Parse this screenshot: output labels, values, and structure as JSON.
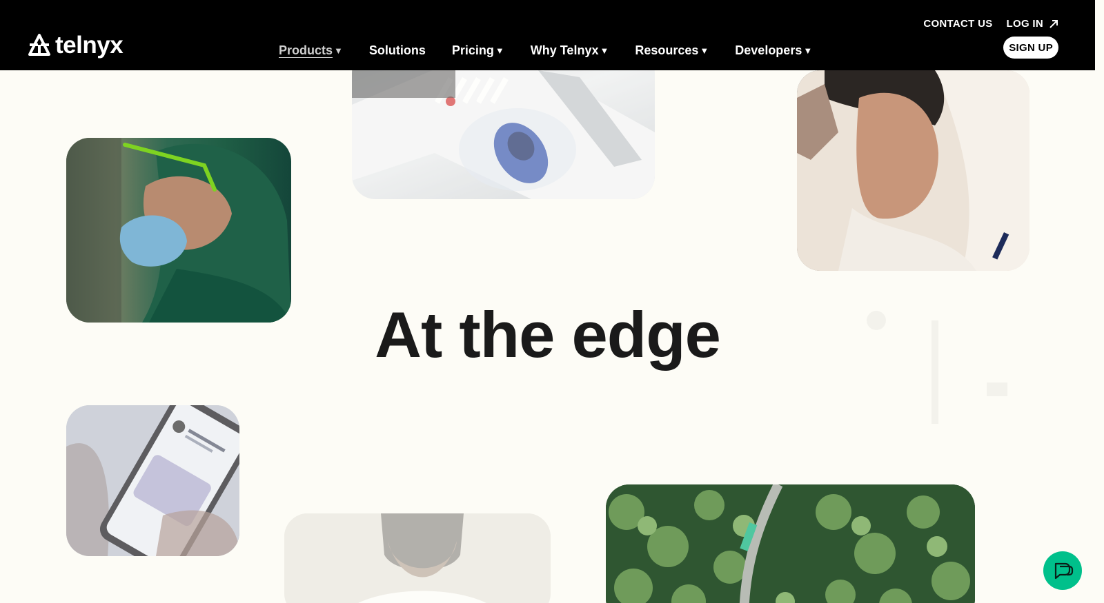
{
  "brand": {
    "name": "telnyx"
  },
  "top_links": {
    "contact": "CONTACT US",
    "login": "LOG IN"
  },
  "nav": [
    {
      "label": "Products",
      "caret": "▼",
      "active": true
    },
    {
      "label": "Solutions",
      "caret": ""
    },
    {
      "label": "Pricing",
      "caret": "▼"
    },
    {
      "label": "Why Telnyx",
      "caret": "▼"
    },
    {
      "label": "Resources",
      "caret": "▼"
    },
    {
      "label": "Developers",
      "caret": "▼"
    }
  ],
  "signup": {
    "label": "SIGN UP"
  },
  "hero": {
    "title": "At the edge"
  },
  "colors": {
    "header_bg": "#000000",
    "page_bg": "#fdfcf6",
    "accent": "#00c08b",
    "title": "#1a1a1a"
  },
  "icons": {
    "logo": "telnyx-logo-icon",
    "login_arrow": "arrow-up-right-icon",
    "caret": "caret-down-icon",
    "chat": "chat-bubble-icon"
  }
}
